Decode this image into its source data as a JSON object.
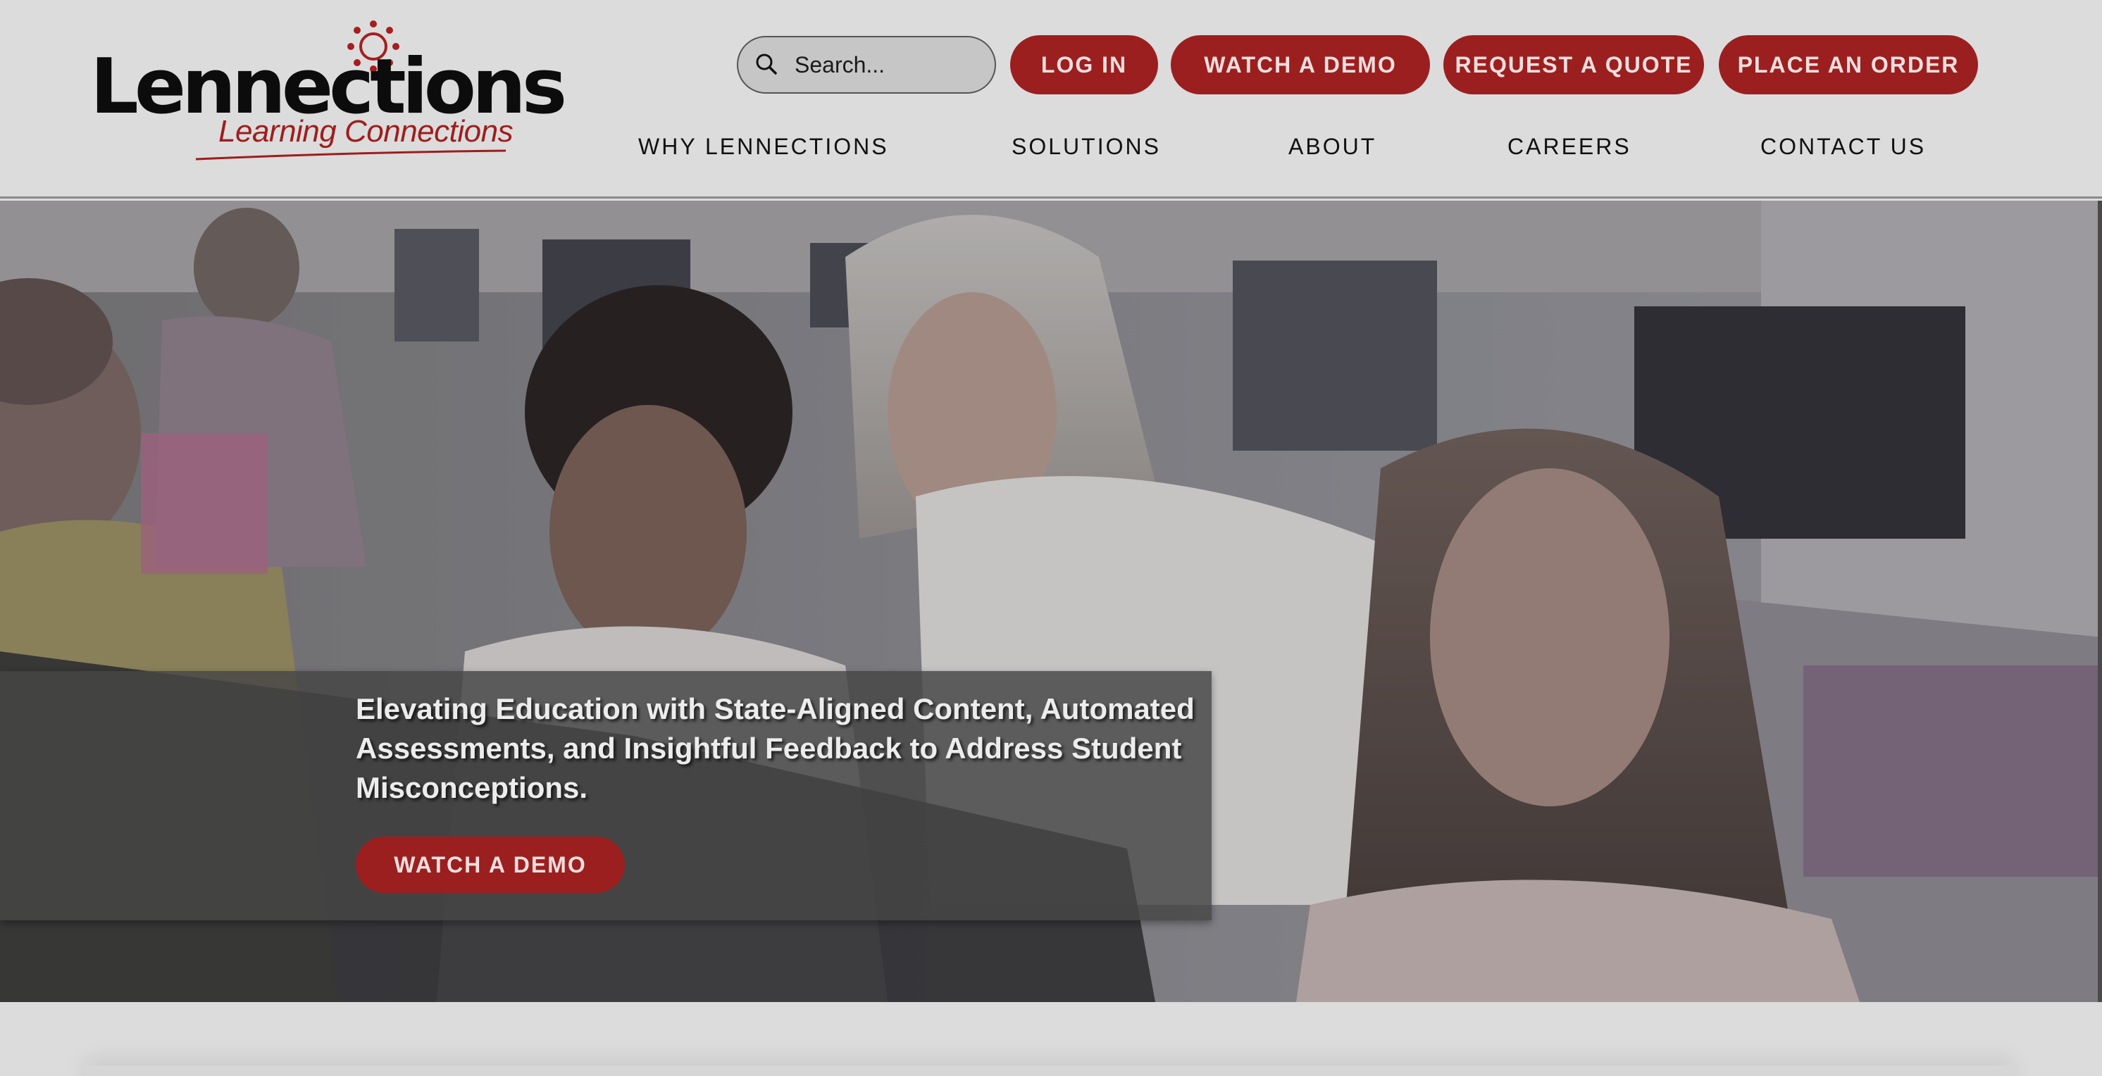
{
  "logo": {
    "name": "Lennections",
    "tagline": "Learning Connections"
  },
  "search": {
    "placeholder": "Search..."
  },
  "buttons": {
    "login": "LOG IN",
    "watch_demo": "WATCH A DEMO",
    "request_quote": "REQUEST A QUOTE",
    "place_order": "PLACE AN ORDER"
  },
  "nav": [
    "WHY LENNECTIONS",
    "SOLUTIONS",
    "ABOUT",
    "CAREERS",
    "CONTACT US"
  ],
  "hero": {
    "caption": "Elevating Education with State-Aligned Content, Automated Assessments, and Insightful Feedback to Address Student Misconceptions.",
    "cta": "WATCH A DEMO"
  },
  "colors": {
    "brand_red": "#9b1f1f",
    "header_bg": "#dcdcdc",
    "caption_overlay": "#464646"
  },
  "icons": [
    "search-icon",
    "sun-logo-icon"
  ]
}
